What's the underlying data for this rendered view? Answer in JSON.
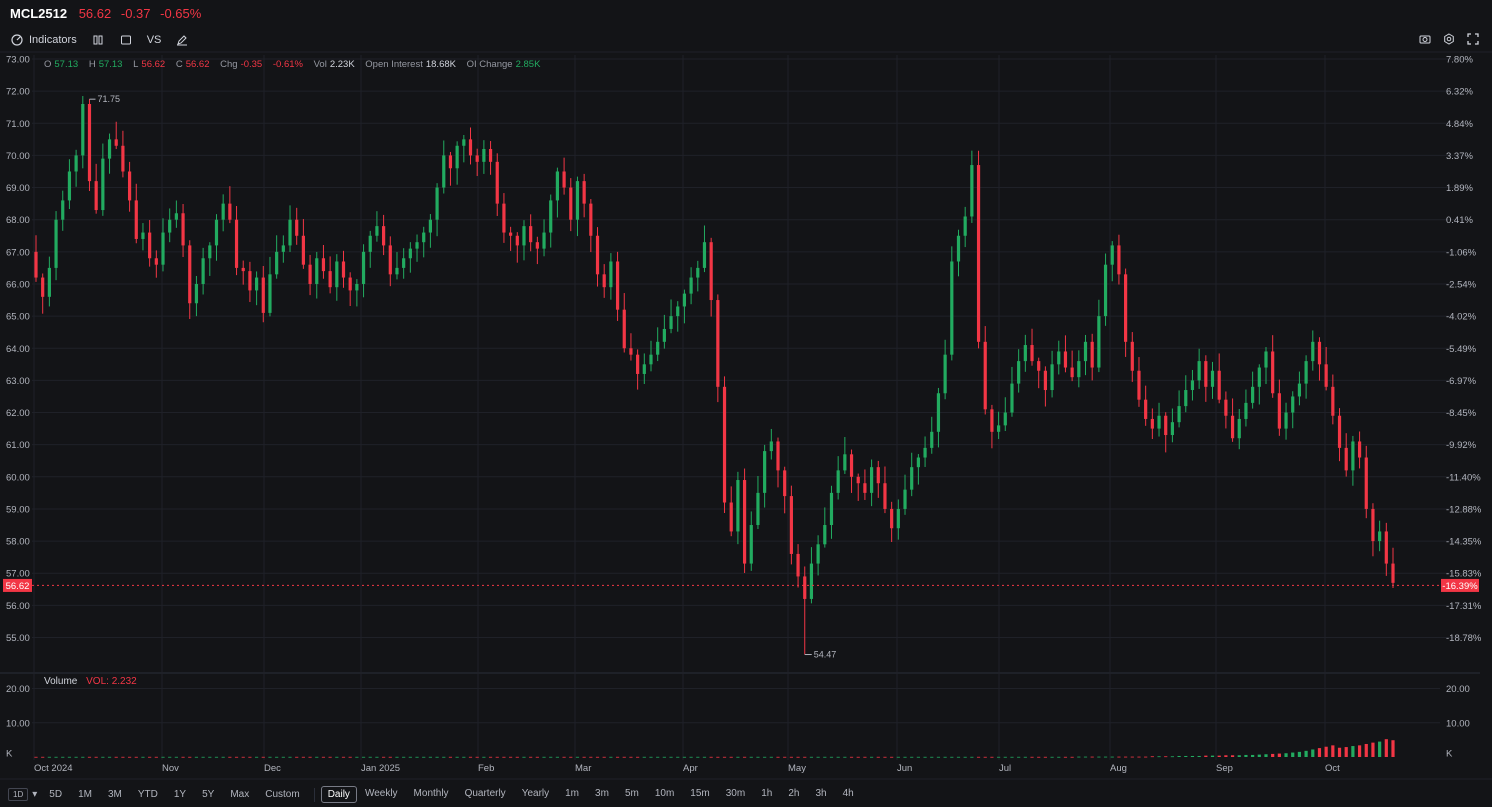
{
  "header": {
    "symbol": "MCL2512",
    "last": "56.62",
    "change": "-0.37",
    "change_pct": "-0.65%"
  },
  "toolbar": {
    "indicators": "Indicators",
    "vs": "VS",
    "icons": [
      "indicators-icon",
      "candle-type-icon",
      "square-icon",
      "draw-icon",
      "camera-icon",
      "settings-icon",
      "fullscreen-icon"
    ]
  },
  "ohlc": {
    "o_label": "O",
    "o": "57.13",
    "h_label": "H",
    "h": "57.13",
    "l_label": "L",
    "l": "56.62",
    "c_label": "C",
    "c": "56.62",
    "chg_label": "Chg",
    "chg": "-0.35",
    "chg_pct": "-0.61%",
    "vol_label": "Vol",
    "vol": "2.23K",
    "oi_label": "Open Interest",
    "oi": "18.68K",
    "oic_label": "OI Change",
    "oic": "2.85K"
  },
  "volume_header": {
    "label": "Volume",
    "value": "VOL: 2.232"
  },
  "current_price_tag": "56.62",
  "current_pct_tag": "-16.39%",
  "colors": {
    "up": "#22ab60",
    "down": "#f23645",
    "background": "#131417",
    "grid": "#1f2128"
  },
  "chart_data": {
    "type": "candlestick",
    "price_axis": {
      "ylim": [
        54.0,
        73.4
      ],
      "ticks": [
        "73.00",
        "72.00",
        "71.00",
        "70.00",
        "69.00",
        "68.00",
        "67.00",
        "66.00",
        "65.00",
        "64.00",
        "63.00",
        "62.00",
        "61.00",
        "60.00",
        "59.00",
        "58.00",
        "57.00",
        "56.00",
        "55.00"
      ]
    },
    "pct_axis": {
      "ticks": [
        "7.80%",
        "6.32%",
        "4.84%",
        "3.37%",
        "1.89%",
        "0.41%",
        "-1.06%",
        "-2.54%",
        "-4.02%",
        "-5.49%",
        "-6.97%",
        "-8.45%",
        "-9.92%",
        "-11.40%",
        "-12.88%",
        "-14.35%",
        "-15.83%",
        "-17.31%",
        "-18.78%"
      ]
    },
    "volume_axis": {
      "ylim": [
        0,
        22
      ],
      "ticks": [
        "20.00",
        "10.00",
        "K"
      ]
    },
    "x_labels": [
      "Oct 2024",
      "Nov",
      "Dec",
      "Jan 2025",
      "Feb",
      "Mar",
      "Apr",
      "May",
      "Jun",
      "Jul",
      "Aug",
      "Sep",
      "Oct"
    ],
    "annotations": [
      {
        "text": "71.75",
        "value": 71.75
      },
      {
        "text": "54.47",
        "value": 54.47
      }
    ],
    "anchors": [
      67.0,
      66.2,
      65.6,
      66.5,
      68.0,
      68.6,
      69.5,
      70.0,
      71.6,
      69.2,
      68.3,
      69.9,
      70.5,
      70.3,
      69.5,
      68.6,
      67.4,
      67.6,
      66.8,
      66.6,
      67.6,
      68.0,
      68.2,
      67.2,
      65.4,
      66.0,
      66.8,
      67.2,
      68.0,
      68.5,
      68.0,
      66.5,
      66.4,
      65.8,
      66.2,
      65.1,
      66.3,
      67.0,
      67.2,
      68.0,
      67.5,
      66.6,
      66.0,
      66.8,
      66.4,
      65.9,
      66.7,
      66.2,
      65.8,
      66.0,
      67.0,
      67.5,
      67.8,
      67.2,
      66.3,
      66.5,
      66.8,
      67.1,
      67.3,
      67.6,
      68.0,
      69.0,
      70.0,
      69.6,
      70.3,
      70.5,
      70.0,
      69.8,
      70.2,
      69.8,
      68.5,
      67.6,
      67.5,
      67.2,
      67.8,
      67.3,
      67.1,
      67.6,
      68.6,
      69.5,
      69.0,
      68.0,
      69.2,
      68.5,
      67.5,
      66.3,
      65.9,
      66.7,
      65.2,
      64.0,
      63.8,
      63.2,
      63.5,
      63.8,
      64.2,
      64.6,
      65.0,
      65.3,
      65.7,
      66.2,
      66.5,
      67.3,
      65.5,
      62.8,
      59.2,
      58.3,
      59.9,
      57.3,
      58.5,
      59.5,
      60.8,
      61.1,
      60.2,
      59.4,
      57.6,
      56.9,
      56.2,
      57.3,
      57.9,
      58.5,
      59.5,
      60.2,
      60.7,
      60.0,
      59.8,
      59.5,
      60.3,
      59.8,
      59.0,
      58.4,
      59.0,
      59.6,
      60.3,
      60.6,
      60.9,
      61.4,
      62.6,
      63.8,
      66.7,
      67.5,
      68.1,
      69.7,
      64.2,
      62.1,
      61.4,
      61.6,
      62.0,
      62.9,
      63.6,
      64.1,
      63.6,
      63.3,
      62.7,
      63.5,
      63.9,
      63.4,
      63.1,
      63.6,
      64.2,
      63.4,
      65.0,
      66.6,
      67.2,
      66.3,
      64.2,
      63.3,
      62.4,
      61.8,
      61.5,
      61.9,
      61.3,
      61.7,
      62.2,
      62.7,
      63.0,
      63.6,
      62.8,
      63.3,
      62.4,
      61.9,
      61.2,
      61.8,
      62.3,
      62.8,
      63.4,
      63.9,
      62.6,
      61.5,
      62.0,
      62.5,
      62.9,
      63.6,
      64.2,
      63.5,
      62.8,
      61.9,
      60.9,
      60.2,
      61.1,
      60.6,
      59.0,
      58.0,
      58.3,
      57.3,
      56.7
    ],
    "volume_values": [
      0.05,
      0.05,
      0.05,
      0.05,
      0.05,
      0.05,
      0.05,
      0.05,
      0.05,
      0.05,
      0.05,
      0.05,
      0.05,
      0.05,
      0.05,
      0.05,
      0.05,
      0.05,
      0.05,
      0.05,
      0.05,
      0.05,
      0.05,
      0.05,
      0.05,
      0.05,
      0.05,
      0.05,
      0.05,
      0.05,
      0.05,
      0.05,
      0.05,
      0.05,
      0.05,
      0.05,
      0.05,
      0.05,
      0.05,
      0.05,
      0.05,
      0.05,
      0.05,
      0.05,
      0.05,
      0.05,
      0.05,
      0.05,
      0.05,
      0.05,
      0.05,
      0.05,
      0.05,
      0.05,
      0.05,
      0.05,
      0.05,
      0.05,
      0.05,
      0.05,
      0.05,
      0.05,
      0.05,
      0.05,
      0.05,
      0.05,
      0.05,
      0.05,
      0.05,
      0.05,
      0.05,
      0.05,
      0.05,
      0.05,
      0.05,
      0.05,
      0.05,
      0.05,
      0.05,
      0.05,
      0.05,
      0.05,
      0.05,
      0.05,
      0.05,
      0.05,
      0.05,
      0.05,
      0.05,
      0.05,
      0.05,
      0.05,
      0.05,
      0.05,
      0.05,
      0.05,
      0.05,
      0.05,
      0.05,
      0.05,
      0.05,
      0.05,
      0.05,
      0.05,
      0.05,
      0.05,
      0.05,
      0.05,
      0.05,
      0.05,
      0.05,
      0.05,
      0.05,
      0.05,
      0.05,
      0.05,
      0.05,
      0.05,
      0.05,
      0.05,
      0.05,
      0.05,
      0.05,
      0.05,
      0.05,
      0.05,
      0.05,
      0.05,
      0.05,
      0.05,
      0.05,
      0.05,
      0.05,
      0.05,
      0.05,
      0.05,
      0.05,
      0.05,
      0.05,
      0.05,
      0.05,
      0.05,
      0.05,
      0.05,
      0.05,
      0.05,
      0.05,
      0.05,
      0.05,
      0.05,
      0.05,
      0.05,
      0.05,
      0.05,
      0.05,
      0.05,
      0.1,
      0.1,
      0.1,
      0.1,
      0.1,
      0.1,
      0.1,
      0.1,
      0.1,
      0.1,
      0.1,
      0.2,
      0.2,
      0.2,
      0.2,
      0.3,
      0.3,
      0.3,
      0.3,
      0.4,
      0.4,
      0.4,
      0.5,
      0.5,
      0.5,
      0.6,
      0.6,
      0.7,
      0.8,
      0.9,
      1.0,
      1.1,
      1.3,
      1.5,
      1.8,
      2.2,
      2.6,
      3.0,
      3.4,
      2.7,
      2.9,
      3.2,
      3.4,
      3.8,
      4.2,
      4.5,
      5.2,
      4.9,
      5.5,
      4.3,
      6.0,
      12.0,
      7.5,
      9.0,
      18.5,
      2.2
    ]
  },
  "bottom_bar": {
    "ranges": [
      "5D",
      "1M",
      "3M",
      "YTD",
      "1Y",
      "5Y",
      "Max",
      "Custom"
    ],
    "intervals": [
      "Daily",
      "Weekly",
      "Monthly",
      "Quarterly",
      "Yearly",
      "1m",
      "3m",
      "5m",
      "10m",
      "15m",
      "30m",
      "1h",
      "2h",
      "3h",
      "4h"
    ],
    "active_interval": "Daily",
    "layout_label": "1D"
  }
}
